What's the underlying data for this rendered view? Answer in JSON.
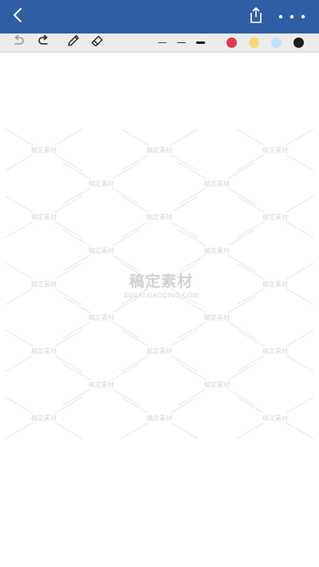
{
  "app": {
    "title": ""
  },
  "topbar": {
    "background": "#2e5fa5",
    "back_icon": "chevron-left-icon",
    "share_icon": "share-icon",
    "more_icon": "more-horizontal-icon"
  },
  "toolbar": {
    "background": "#ececec",
    "tools": [
      "undo-icon",
      "redo-icon",
      "pen-icon",
      "eraser-icon"
    ],
    "stroke_widths": [
      "thin",
      "medium",
      "thick"
    ],
    "colors": [
      {
        "name": "red",
        "hex": "#e0394a"
      },
      {
        "name": "yellow",
        "hex": "#f7d974"
      },
      {
        "name": "light-blue",
        "hex": "#bfe3f7"
      },
      {
        "name": "black",
        "hex": "#1e1e1e"
      }
    ]
  },
  "watermark": {
    "cn_text": "稿定素材",
    "en_text": "SUCAI.GAODING.COM"
  }
}
